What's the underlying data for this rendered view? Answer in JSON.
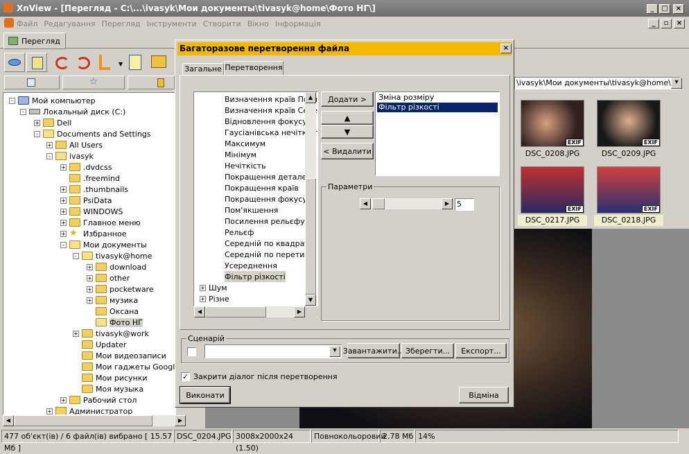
{
  "window": {
    "title": "XnView - [Перегляд - C:\\...\\ivasyk\\Мои документы\\tivasyk@home\\Фото НГ\\]"
  },
  "menu": [
    "Файл",
    "Редагування",
    "Перегляд",
    "Інструменти",
    "Створити",
    "Вікно",
    "Інформація"
  ],
  "tab": {
    "label": "Перегляд"
  },
  "path_bar": "\\ivasyk\\Мои документы\\tivasyk@home\\Фото",
  "tree": [
    {
      "label": "Мой компьютер",
      "icon": "computer-icon"
    },
    {
      "label": "Локальный диск (C:)",
      "icon": "drive-icon"
    },
    {
      "label": "Dell",
      "icon": "folder-icon"
    },
    {
      "label": "Documents and Settings",
      "icon": "folder-icon"
    },
    {
      "label": "All Users",
      "icon": "folder-icon"
    },
    {
      "label": "ivasyk",
      "icon": "folder-icon"
    },
    {
      "label": ".dvdcss",
      "icon": "folder-icon"
    },
    {
      "label": ".freemind",
      "icon": "folder-icon"
    },
    {
      "label": ".thumbnails",
      "icon": "folder-icon"
    },
    {
      "label": "PsiData",
      "icon": "folder-icon"
    },
    {
      "label": "WINDOWS",
      "icon": "folder-icon"
    },
    {
      "label": "Главное меню",
      "icon": "folder-icon"
    },
    {
      "label": "Избранное",
      "icon": "star-icon"
    },
    {
      "label": "Мои документы",
      "icon": "folder-icon"
    },
    {
      "label": "tivasyk@home",
      "icon": "folder-icon"
    },
    {
      "label": "download",
      "icon": "folder-icon"
    },
    {
      "label": "other",
      "icon": "folder-icon"
    },
    {
      "label": "pocketware",
      "icon": "folder-icon"
    },
    {
      "label": "музика",
      "icon": "folder-icon"
    },
    {
      "label": "Оксана",
      "icon": "folder-icon"
    },
    {
      "label": "Фото НГ",
      "icon": "folder-icon"
    },
    {
      "label": "tivasyk@work",
      "icon": "folder-icon"
    },
    {
      "label": "Updater",
      "icon": "folder-icon"
    },
    {
      "label": "Мои видеозаписи",
      "icon": "video-folder-icon"
    },
    {
      "label": "Мои гаджеты Google",
      "icon": "folder-icon"
    },
    {
      "label": "Мои рисунки",
      "icon": "pictures-folder-icon"
    },
    {
      "label": "Моя музыка",
      "icon": "music-folder-icon"
    },
    {
      "label": "Рабочий стол",
      "icon": "folder-icon"
    },
    {
      "label": "Администратор",
      "icon": "folder-icon"
    }
  ],
  "thumbnails": [
    {
      "name": "DSC_0208.JPG",
      "badge": "EXIF"
    },
    {
      "name": "DSC_0209.JPG",
      "badge": "EXIF"
    },
    {
      "name": "DSC_0217.JPG",
      "badge": "EXIF"
    },
    {
      "name": "DSC_0218.JPG",
      "badge": "EXIF"
    }
  ],
  "dialog": {
    "title": "Багаторазове перетворення файла",
    "tabs": [
      "Загальне",
      "Перетворення"
    ],
    "filters": [
      "Визначення країв Посл",
      "Визначення країв Сере",
      "Відновлення фокусу",
      "Гаусіанівська нечіткіст",
      "Максимум",
      "Мінімум",
      "Нечіткість",
      "Покращення деталей",
      "Покращення країв",
      "Покращення фокусу",
      "Пом'якшення",
      "Посилення рельєфу",
      "Рельєф",
      "Середній по квадрату",
      "Середній по перетину",
      "Усереднення",
      "Фільтр різкості"
    ],
    "groups": [
      "Шум",
      "Різне"
    ],
    "add_button": "Додати >",
    "remove_button": "< Видалити",
    "applied": [
      "Зміна розміру",
      "Фільтр різкості"
    ],
    "params_label": "Параметри",
    "param_value": "5",
    "scenario_label": "Сценарій",
    "load_button": "Завантажити...",
    "save_button": "Зберегти...",
    "export_button": "Експорт...",
    "close_checkbox_label": "Закрити діалог після перетворення",
    "execute_button": "Виконати",
    "cancel_button": "Відміна"
  },
  "status": {
    "count": "477 об'єкт(ів) / 6 файл(ів) вибрано   [ 15.57 Мб ]",
    "file": "DSC_0204.JPG",
    "dims": "3008x2000x24 (1.50)",
    "color": "Повнокольоровий",
    "size": "2.78 Мб",
    "zoom": "14%"
  }
}
